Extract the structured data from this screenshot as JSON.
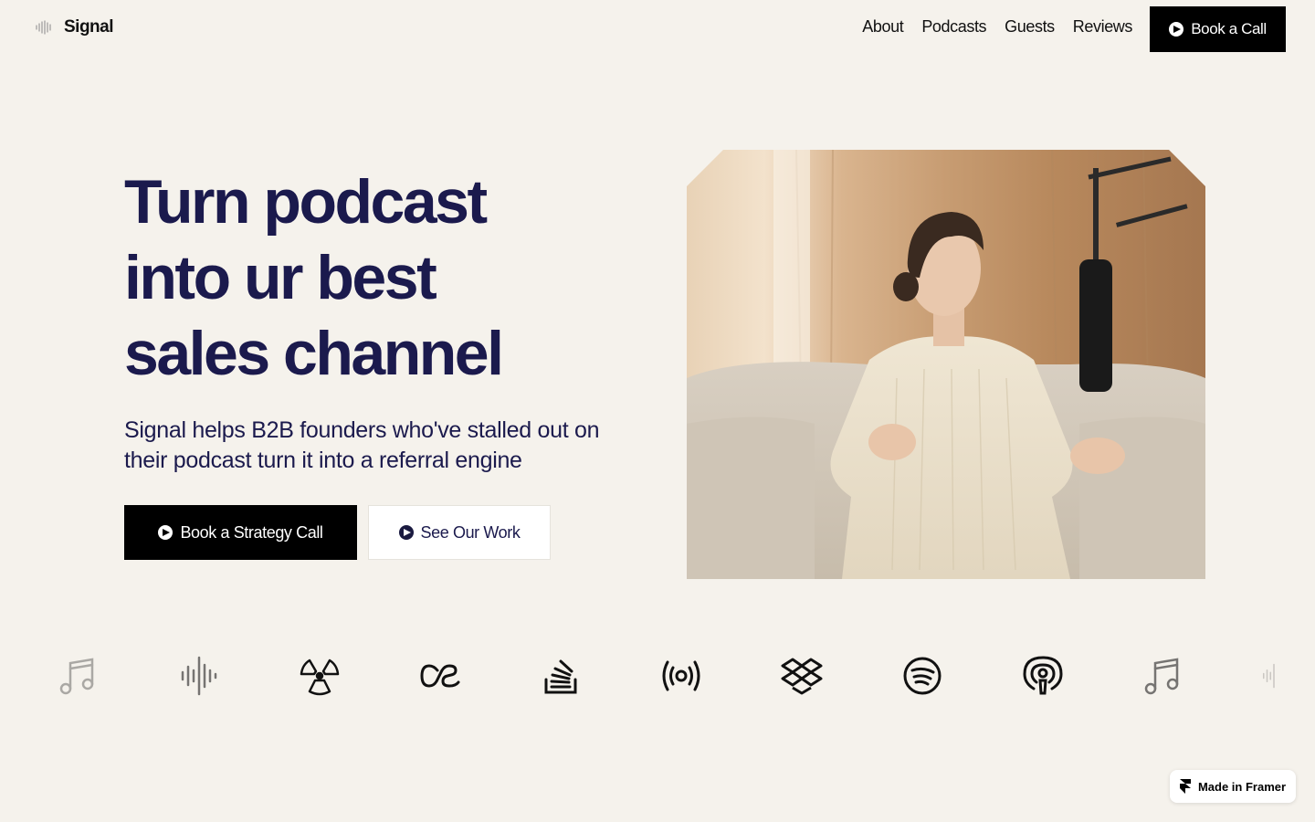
{
  "brand": {
    "name": "Signal"
  },
  "nav": {
    "items": [
      "About",
      "Podcasts",
      "Guests",
      "Reviews"
    ],
    "cta_label": "Book a Call"
  },
  "hero": {
    "title_lines": [
      "Turn podcast",
      "into ur best",
      "sales channel"
    ],
    "subtitle": "Signal helps B2B founders who've stalled out on their podcast turn it into a referral engine",
    "primary_cta": "Book a Strategy Call",
    "secondary_cta": "See Our Work",
    "image_alt": "Woman speaking into a microphone on a sofa"
  },
  "logo_strip": {
    "icons": [
      "music-note-icon",
      "audio-waveform-icon",
      "radiation-icon",
      "lastfm-icon",
      "stack-overflow-icon",
      "broadcast-icon",
      "dropbox-icon",
      "spotify-icon",
      "apple-podcasts-icon",
      "music-note-icon",
      "audio-waveform-icon"
    ]
  },
  "badge": {
    "label": "Made in Framer"
  },
  "colors": {
    "background": "#f5f2ec",
    "heading": "#1b1a4d",
    "button": "#000000"
  }
}
